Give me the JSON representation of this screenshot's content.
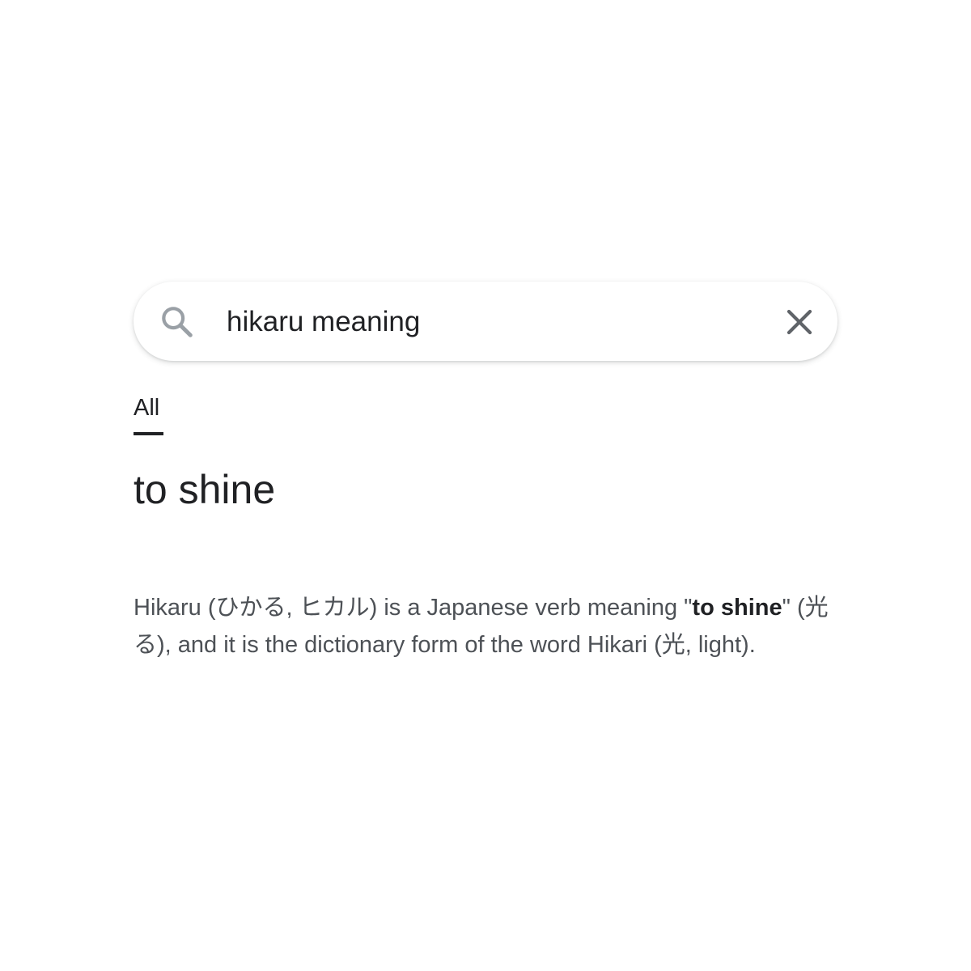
{
  "search": {
    "query": "hikaru meaning",
    "search_icon": "search-icon",
    "clear_icon": "close-icon"
  },
  "tabs": [
    {
      "label": "All",
      "selected": true
    }
  ],
  "answer": {
    "title": "to shine"
  },
  "snippet": {
    "part1": "Hikaru (ひかる, ヒカル) is a Japanese verb meaning \"",
    "bold1": "to shine",
    "part2": "\" (光る), and it is the dictionary form of the word Hikari (光, light)."
  },
  "colors": {
    "background": "#ffffff",
    "text_primary": "#202124",
    "text_secondary": "#4d5156",
    "icon": "#70757a"
  }
}
